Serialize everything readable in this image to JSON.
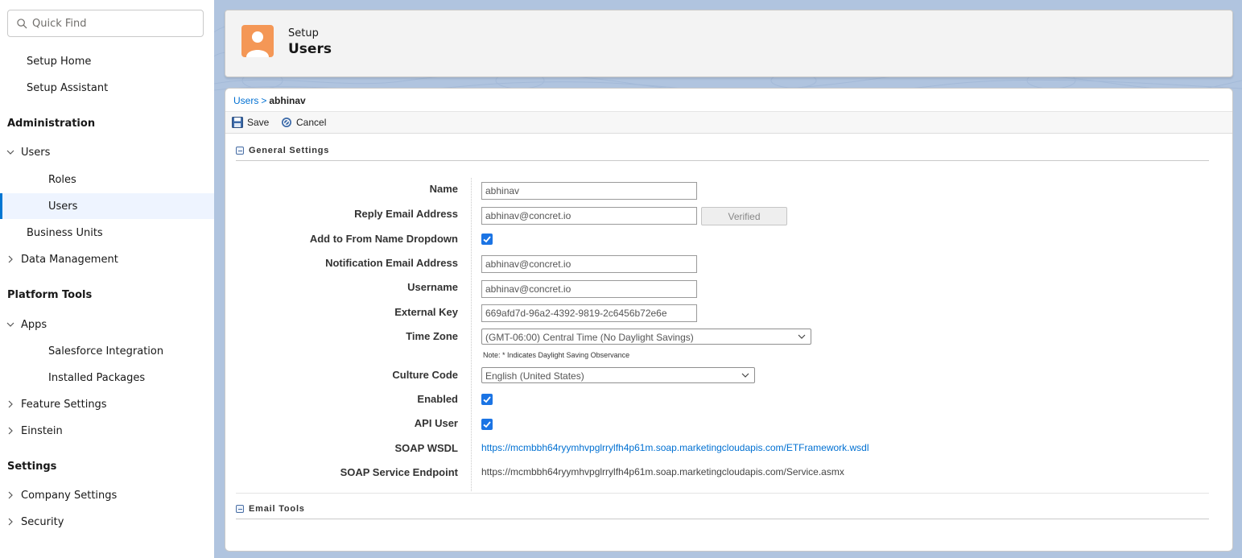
{
  "sidebar": {
    "quick_find_placeholder": "Quick Find",
    "setup_home": "Setup Home",
    "setup_assistant": "Setup Assistant",
    "administration_heading": "Administration",
    "users_group": "Users",
    "roles": "Roles",
    "users": "Users",
    "business_units": "Business Units",
    "data_management": "Data Management",
    "platform_tools_heading": "Platform Tools",
    "apps": "Apps",
    "salesforce_integration": "Salesforce Integration",
    "installed_packages": "Installed Packages",
    "feature_settings": "Feature Settings",
    "einstein": "Einstein",
    "settings_heading": "Settings",
    "company_settings": "Company Settings",
    "security": "Security"
  },
  "header": {
    "setup_label": "Setup",
    "title": "Users"
  },
  "breadcrumb": {
    "parent": "Users",
    "separator": ">",
    "current": "abhinav"
  },
  "toolbar": {
    "save_label": "Save",
    "cancel_label": "Cancel"
  },
  "general_settings": {
    "heading": "General Settings",
    "name_label": "Name",
    "name_value": "abhinav",
    "reply_email_label": "Reply Email Address",
    "reply_email_value": "abhinav@concret.io",
    "verified_label": "Verified",
    "add_from_name_label": "Add to From Name Dropdown",
    "add_from_name_checked": true,
    "notification_email_label": "Notification Email Address",
    "notification_email_value": "abhinav@concret.io",
    "username_label": "Username",
    "username_value": "abhinav@concret.io",
    "external_key_label": "External Key",
    "external_key_value": "669afd7d-96a2-4392-9819-2c6456b72e6e",
    "time_zone_label": "Time Zone",
    "time_zone_value": "(GMT-06:00) Central Time (No Daylight Savings)",
    "time_zone_note": "Note: * Indicates Daylight Saving Observance",
    "culture_code_label": "Culture Code",
    "culture_code_value": "English (United States)",
    "enabled_label": "Enabled",
    "enabled_checked": true,
    "api_user_label": "API User",
    "api_user_checked": true,
    "soap_wsdl_label": "SOAP WSDL",
    "soap_wsdl_value": "https://mcmbbh64ryymhvpglrrylfh4p61m.soap.marketingcloudapis.com/ETFramework.wsdl",
    "soap_endpoint_label": "SOAP Service Endpoint",
    "soap_endpoint_value": "https://mcmbbh64ryymhvpglrrylfh4p61m.soap.marketingcloudapis.com/Service.asmx"
  },
  "email_tools": {
    "heading": "Email Tools"
  },
  "colors": {
    "accent_blue": "#0176d3",
    "header_icon_orange": "#f49756",
    "link_blue": "#0070d2",
    "checkbox_blue": "#1b74e4"
  },
  "icons": {
    "quick_find": "search-icon",
    "header": "user-avatar-icon",
    "save": "floppy-disk-icon",
    "cancel": "cancel-circle-icon",
    "expand": "chevron-right-icon",
    "collapse": "chevron-down-icon"
  }
}
